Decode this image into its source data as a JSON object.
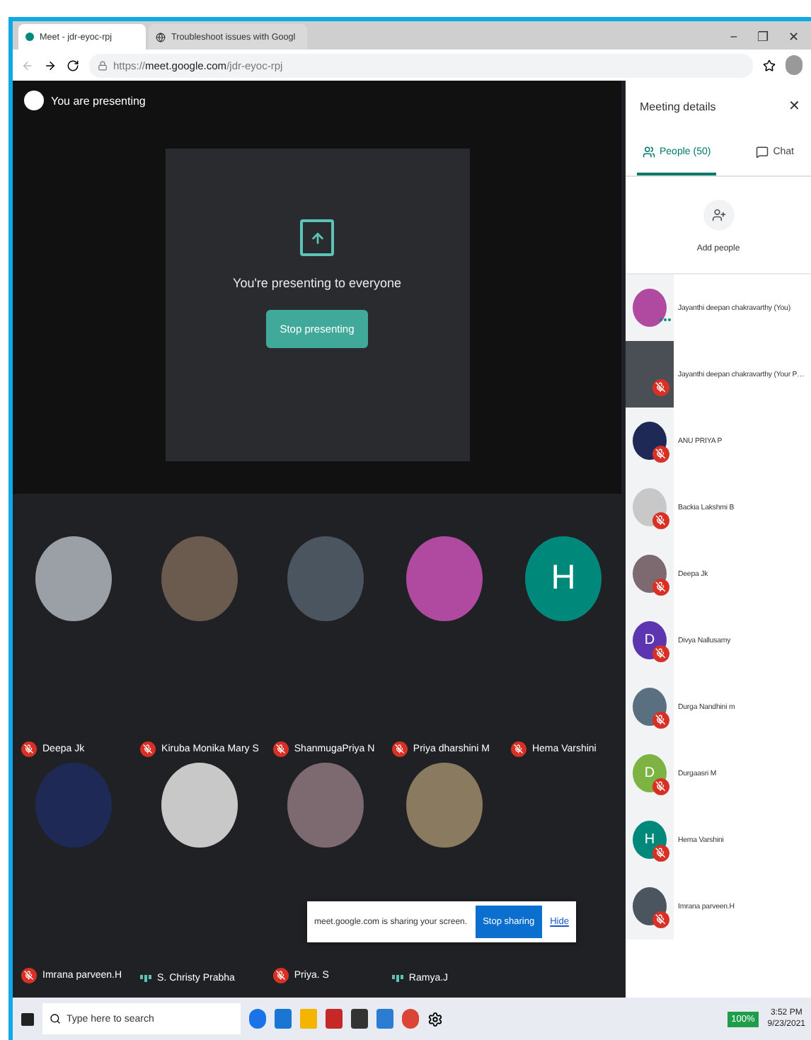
{
  "browser": {
    "tabs": [
      {
        "title": "Meet - jdr-eyoc-rpj",
        "selected": true
      },
      {
        "title": "Troubleshoot issues with Googl",
        "selected": false
      }
    ],
    "window_controls": [
      "−",
      "❐",
      "✕"
    ],
    "url": {
      "scheme": "https://",
      "host": "meet.google.com",
      "path": "/jdr-eyoc-rpj"
    }
  },
  "presenting": {
    "banner": "You are presenting",
    "message": "You're presenting to everyone",
    "button": "Stop presenting"
  },
  "tiles": [
    {
      "name": "Deepa Jk",
      "kind": "photo",
      "muted": true
    },
    {
      "name": "Kiruba Monika Mary S",
      "kind": "photo",
      "muted": true
    },
    {
      "name": "ShanmugaPriya N",
      "kind": "photo",
      "muted": true
    },
    {
      "name": "Priya dharshini M",
      "kind": "photo",
      "muted": true
    },
    {
      "name": "Hema Varshini",
      "kind": "letter",
      "letter": "H",
      "color": "#00897b",
      "muted": true
    },
    {
      "name": "Imrana parveen.H",
      "kind": "photo",
      "muted": true
    },
    {
      "name": "S. Christy Prabha",
      "kind": "photo",
      "muted": false
    },
    {
      "name": "Priya. S",
      "kind": "photo",
      "muted": true
    },
    {
      "name": "Ramya.J",
      "kind": "photo",
      "muted": false
    }
  ],
  "share_bar": {
    "message": "meet.google.com is sharing your screen.",
    "stop": "Stop sharing",
    "hide": "Hide"
  },
  "panel": {
    "title": "Meeting details",
    "close": "✕",
    "tabs": [
      {
        "label": "People (50)",
        "kind": "people",
        "selected": true
      },
      {
        "label": "Chat",
        "kind": "chat",
        "selected": false
      }
    ],
    "add": "Add people",
    "people": [
      {
        "name": "Jayanthi deepan chakravarthy (You)",
        "kind": "photo",
        "muted": false
      },
      {
        "name": "Jayanthi deepan chakravarthy (Your P…",
        "kind": "screen",
        "muted": true
      },
      {
        "name": "ANU PRIYA P",
        "kind": "photo",
        "muted": true
      },
      {
        "name": "Backia Lakshmi B",
        "kind": "photo",
        "muted": true
      },
      {
        "name": "Deepa Jk",
        "kind": "photo",
        "muted": true
      },
      {
        "name": "Divya Nallusamy",
        "kind": "letter",
        "letter": "D",
        "color": "#5e35b1",
        "muted": true
      },
      {
        "name": "Durga Nandhini m",
        "kind": "photo",
        "muted": true
      },
      {
        "name": "Durgaasri M",
        "kind": "letter",
        "letter": "D",
        "color": "#7cb342",
        "muted": true
      },
      {
        "name": "Hema Varshini",
        "kind": "letter",
        "letter": "H",
        "color": "#00897b",
        "muted": true
      },
      {
        "name": "Imrana parveen.H",
        "kind": "photo",
        "muted": true
      }
    ]
  },
  "taskbar": {
    "search_placeholder": "Type here to search",
    "battery": "100%",
    "time": "3:52 PM",
    "date": "9/23/2021"
  }
}
